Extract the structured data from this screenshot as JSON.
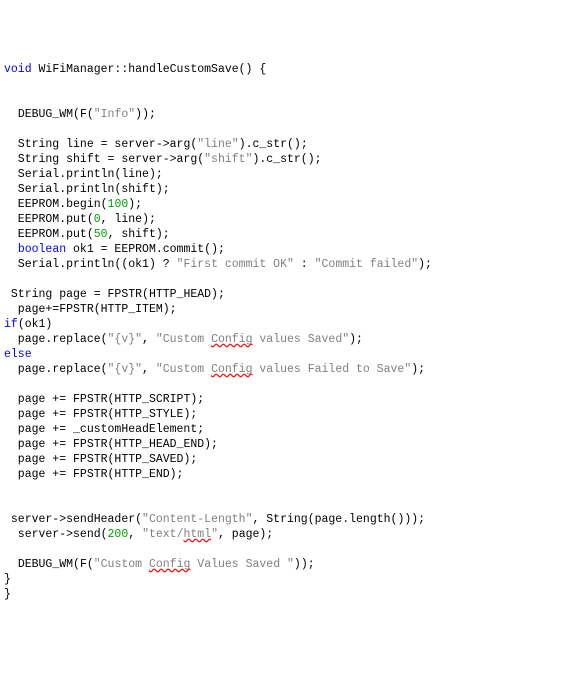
{
  "tokens": [
    {
      "cls": "kw",
      "t": "void"
    },
    {
      "t": " WiFiManager::"
    },
    {
      "cls": "fn",
      "t": "handleCustomSave"
    },
    {
      "t": "() {\n"
    },
    {
      "t": "\n"
    },
    {
      "t": "\n"
    },
    {
      "t": "  "
    },
    {
      "cls": "fn",
      "t": "DEBUG_WM"
    },
    {
      "t": "("
    },
    {
      "cls": "fn",
      "t": "F"
    },
    {
      "t": "("
    },
    {
      "cls": "str",
      "t": "\"Info\""
    },
    {
      "t": "));\n"
    },
    {
      "t": "\n"
    },
    {
      "t": "  String line = server->"
    },
    {
      "cls": "fn",
      "t": "arg"
    },
    {
      "t": "("
    },
    {
      "cls": "str",
      "t": "\"line\""
    },
    {
      "t": ")."
    },
    {
      "cls": "fn",
      "t": "c_str"
    },
    {
      "t": "();\n"
    },
    {
      "t": "  String shift = server->"
    },
    {
      "cls": "fn",
      "t": "arg"
    },
    {
      "t": "("
    },
    {
      "cls": "str",
      "t": "\"shift\""
    },
    {
      "t": ")."
    },
    {
      "cls": "fn",
      "t": "c_str"
    },
    {
      "t": "();\n"
    },
    {
      "t": "  Serial."
    },
    {
      "cls": "fn",
      "t": "println"
    },
    {
      "t": "(line);\n"
    },
    {
      "t": "  Serial."
    },
    {
      "cls": "fn",
      "t": "println"
    },
    {
      "t": "(shift);\n"
    },
    {
      "t": "  EEPROM."
    },
    {
      "cls": "fn",
      "t": "begin"
    },
    {
      "t": "("
    },
    {
      "cls": "num",
      "t": "100"
    },
    {
      "t": ");\n"
    },
    {
      "t": "  EEPROM."
    },
    {
      "cls": "fn",
      "t": "put"
    },
    {
      "t": "("
    },
    {
      "cls": "num",
      "t": "0"
    },
    {
      "t": ", line);\n"
    },
    {
      "t": "  EEPROM."
    },
    {
      "cls": "fn",
      "t": "put"
    },
    {
      "t": "("
    },
    {
      "cls": "num",
      "t": "50"
    },
    {
      "t": ", shift);\n"
    },
    {
      "t": "  "
    },
    {
      "cls": "kw",
      "t": "boolean"
    },
    {
      "t": " ok1 = EEPROM."
    },
    {
      "cls": "fn",
      "t": "commit"
    },
    {
      "t": "();\n"
    },
    {
      "t": "  Serial."
    },
    {
      "cls": "fn",
      "t": "println"
    },
    {
      "t": "((ok1) ? "
    },
    {
      "cls": "str",
      "t": "\"First commit OK\""
    },
    {
      "t": " : "
    },
    {
      "cls": "str",
      "t": "\"Commit failed\""
    },
    {
      "t": ");\n"
    },
    {
      "t": "\n"
    },
    {
      "t": " String page = "
    },
    {
      "cls": "fn",
      "t": "FPSTR"
    },
    {
      "t": "(HTTP_HEAD);\n"
    },
    {
      "t": "  page+="
    },
    {
      "cls": "fn",
      "t": "FPSTR"
    },
    {
      "t": "(HTTP_ITEM);\n"
    },
    {
      "cls": "kw",
      "t": "if"
    },
    {
      "t": "(ok1)\n"
    },
    {
      "t": "  page."
    },
    {
      "cls": "fn",
      "t": "replace"
    },
    {
      "t": "("
    },
    {
      "cls": "str",
      "t": "\"{v}\""
    },
    {
      "t": ", "
    },
    {
      "cls": "str",
      "t": "\"Custom "
    },
    {
      "cls": "str squiggle",
      "t": "Config"
    },
    {
      "cls": "str",
      "t": " values Saved\""
    },
    {
      "t": ");\n"
    },
    {
      "cls": "kw",
      "t": "else"
    },
    {
      "t": "\n"
    },
    {
      "t": "  page."
    },
    {
      "cls": "fn",
      "t": "replace"
    },
    {
      "t": "("
    },
    {
      "cls": "str",
      "t": "\"{v}\""
    },
    {
      "t": ", "
    },
    {
      "cls": "str",
      "t": "\"Custom "
    },
    {
      "cls": "str squiggle",
      "t": "Config"
    },
    {
      "cls": "str",
      "t": " values Failed to Save\""
    },
    {
      "t": ");\n"
    },
    {
      "t": "\n"
    },
    {
      "t": "  page += "
    },
    {
      "cls": "fn",
      "t": "FPSTR"
    },
    {
      "t": "(HTTP_SCRIPT);\n"
    },
    {
      "t": "  page += "
    },
    {
      "cls": "fn",
      "t": "FPSTR"
    },
    {
      "t": "(HTTP_STYLE);\n"
    },
    {
      "t": "  page += _customHeadElement;\n"
    },
    {
      "t": "  page += "
    },
    {
      "cls": "fn",
      "t": "FPSTR"
    },
    {
      "t": "(HTTP_HEAD_END);\n"
    },
    {
      "t": "  page += "
    },
    {
      "cls": "fn",
      "t": "FPSTR"
    },
    {
      "t": "(HTTP_SAVED);\n"
    },
    {
      "t": "  page += "
    },
    {
      "cls": "fn",
      "t": "FPSTR"
    },
    {
      "t": "(HTTP_END);\n"
    },
    {
      "t": "\n"
    },
    {
      "t": "\n"
    },
    {
      "t": " server->"
    },
    {
      "cls": "fn",
      "t": "sendHeader"
    },
    {
      "t": "("
    },
    {
      "cls": "str",
      "t": "\"Content-Length\""
    },
    {
      "t": ", "
    },
    {
      "cls": "fn",
      "t": "String"
    },
    {
      "t": "(page."
    },
    {
      "cls": "fn",
      "t": "length"
    },
    {
      "t": "()));\n"
    },
    {
      "t": "  server->"
    },
    {
      "cls": "fn",
      "t": "send"
    },
    {
      "t": "("
    },
    {
      "cls": "num",
      "t": "200"
    },
    {
      "t": ", "
    },
    {
      "cls": "str",
      "t": "\"text/"
    },
    {
      "cls": "str squiggle",
      "t": "html"
    },
    {
      "cls": "str",
      "t": "\""
    },
    {
      "t": ", page);\n"
    },
    {
      "t": "\n"
    },
    {
      "t": "  "
    },
    {
      "cls": "fn",
      "t": "DEBUG_WM"
    },
    {
      "t": "("
    },
    {
      "cls": "fn",
      "t": "F"
    },
    {
      "t": "("
    },
    {
      "cls": "str",
      "t": "\"Custom "
    },
    {
      "cls": "str squiggle",
      "t": "Config"
    },
    {
      "cls": "str",
      "t": " Values Saved \""
    },
    {
      "t": "));\n"
    },
    {
      "t": "}\n"
    },
    {
      "t": "}"
    }
  ]
}
